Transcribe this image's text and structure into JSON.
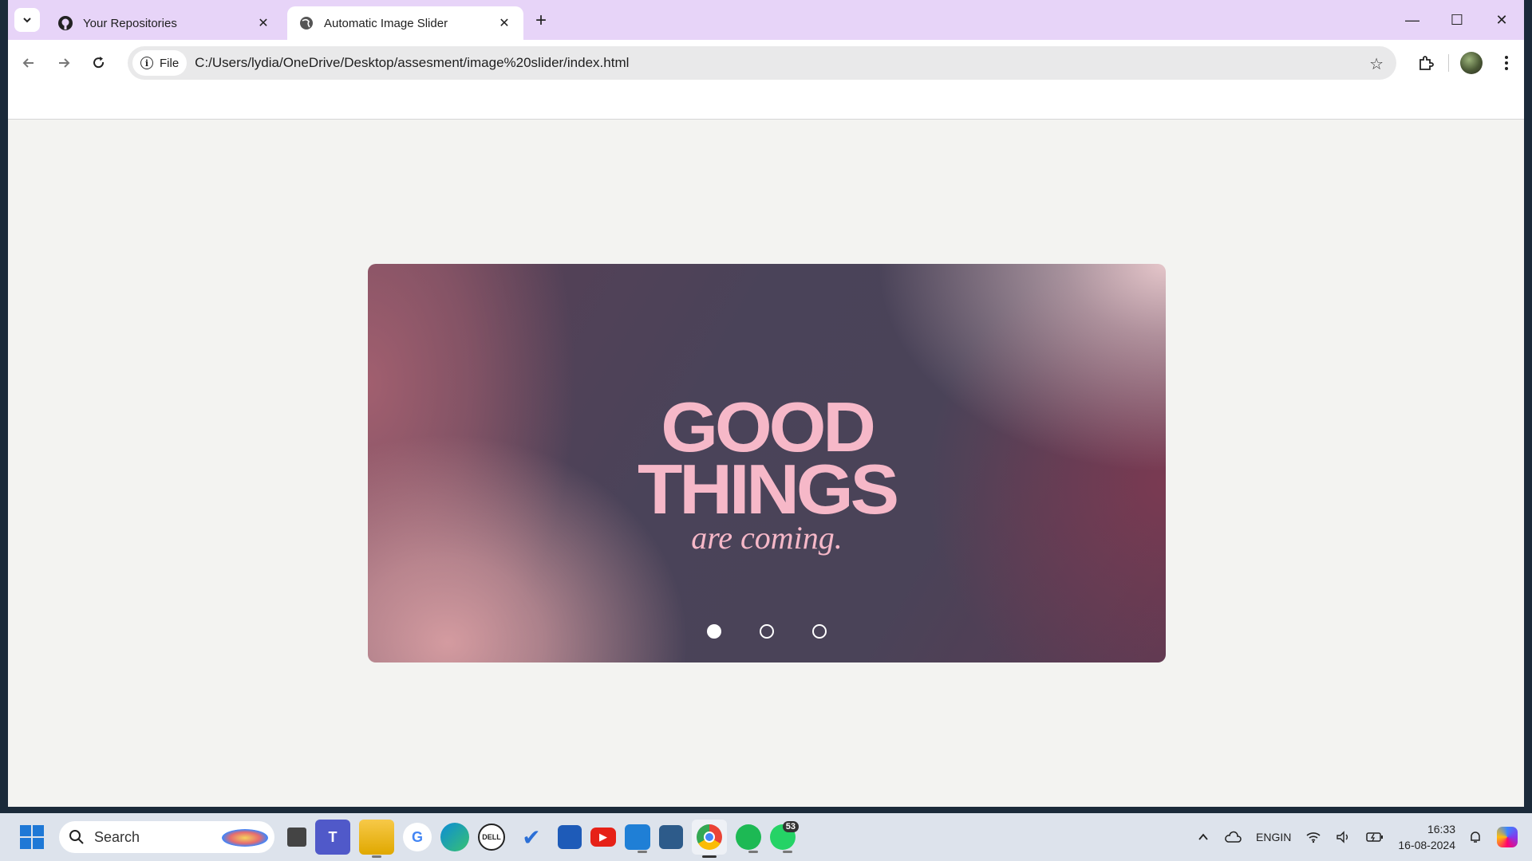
{
  "browser": {
    "tabs": [
      {
        "title": "Your Repositories",
        "favicon": "github-icon",
        "active": false
      },
      {
        "title": "Automatic Image Slider",
        "favicon": "globe-icon",
        "active": true
      }
    ],
    "omnibox": {
      "chip_label": "File",
      "url": "C:/Users/lydia/OneDrive/Desktop/assesment/image%20slider/index.html"
    }
  },
  "slider": {
    "slides_total": 3,
    "active_index": 0,
    "headline_line1": "GOOD",
    "headline_line2": "THINGS",
    "tagline": "are coming.",
    "text_color": "#f6b8c8"
  },
  "taskbar": {
    "search_placeholder": "Search",
    "apps": [
      {
        "name": "file-manager-icon",
        "label": ""
      },
      {
        "name": "teams-icon",
        "label": "T"
      },
      {
        "name": "file-explorer-icon",
        "label": ""
      },
      {
        "name": "google-icon",
        "label": "G"
      },
      {
        "name": "edge-icon",
        "label": ""
      },
      {
        "name": "dell-icon",
        "label": "DELL"
      },
      {
        "name": "todo-icon",
        "label": "✔"
      },
      {
        "name": "store-icon",
        "label": ""
      },
      {
        "name": "youtube-icon",
        "label": "▶"
      },
      {
        "name": "vscode-icon",
        "label": ""
      },
      {
        "name": "mysql-workbench-icon",
        "label": ""
      },
      {
        "name": "chrome-icon",
        "label": ""
      },
      {
        "name": "spotify-icon",
        "label": ""
      },
      {
        "name": "whatsapp-icon",
        "label": ""
      }
    ],
    "whatsapp_badge": "53",
    "lang_line1": "ENG",
    "lang_line2": "IN",
    "time": "16:33",
    "date": "16-08-2024"
  }
}
